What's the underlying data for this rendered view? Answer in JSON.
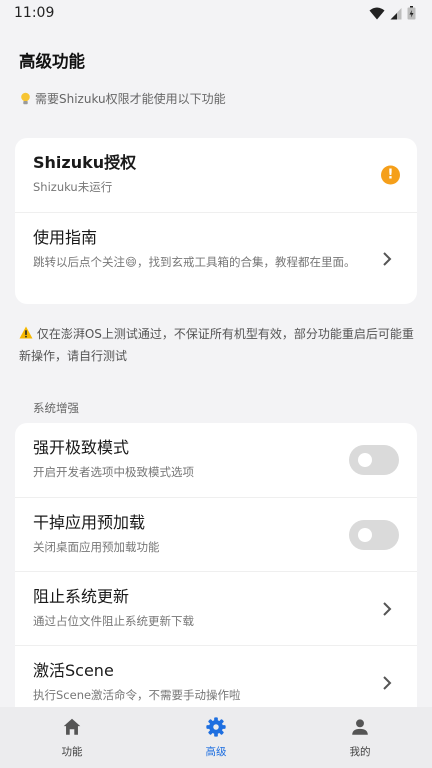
{
  "status_bar": {
    "time": "11:09"
  },
  "page": {
    "title": "高级功能"
  },
  "hint": {
    "icon": "lightbulb-icon",
    "text": "需要Shizuku权限才能使用以下功能"
  },
  "card_shizuku": {
    "auth": {
      "title": "Shizuku授权",
      "subtitle": "Shizuku未运行",
      "badge": "!"
    },
    "guide": {
      "title": "使用指南",
      "subtitle": "跳转以后点个关注😄，找到玄戒工具箱的合集，教程都在里面。"
    }
  },
  "notice": {
    "icon": "warning-icon",
    "text": "仅在澎湃OS上测试通过，不保证所有机型有效，部分功能重启后可能重新操作，请自行测试"
  },
  "section": {
    "label": "系统增强"
  },
  "system_items": [
    {
      "title": "强开极致模式",
      "subtitle": "开启开发者选项中极致模式选项",
      "control": "toggle",
      "on": false
    },
    {
      "title": "干掉应用预加载",
      "subtitle": "关闭桌面应用预加载功能",
      "control": "toggle",
      "on": false
    },
    {
      "title": "阻止系统更新",
      "subtitle": "通过占位文件阻止系统更新下载",
      "control": "chevron"
    },
    {
      "title": "激活Scene",
      "subtitle": "执行Scene激活命令，不需要手动操作啦",
      "control": "chevron"
    }
  ],
  "bottom_nav": {
    "items": [
      {
        "label": "功能",
        "icon": "home-icon",
        "active": false
      },
      {
        "label": "高级",
        "icon": "gear-icon",
        "active": true
      },
      {
        "label": "我的",
        "icon": "person-icon",
        "active": false
      }
    ]
  },
  "colors": {
    "accent": "#1e6fe0",
    "warning": "#f59f1a",
    "background": "#f3f3f5"
  }
}
